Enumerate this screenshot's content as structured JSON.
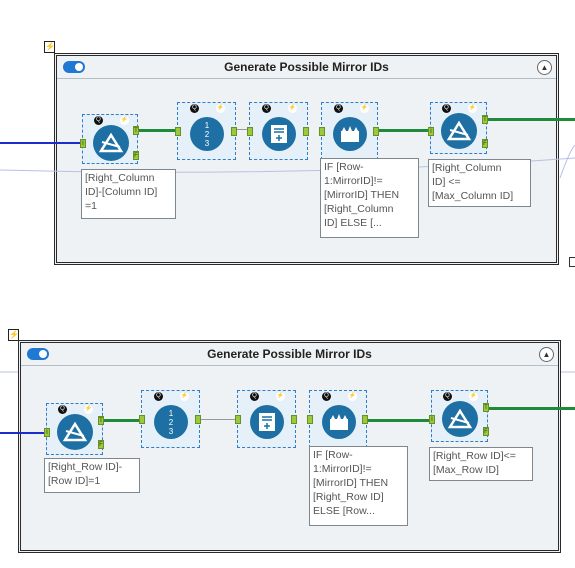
{
  "containers": [
    {
      "title": "Generate Possible Mirror IDs",
      "filter1_annotation": "[Right_Column\nID]-[Column ID]\n=1",
      "multirow_annotation": "IF [Row-\n1:MirrorID]!=\n[MirrorID] THEN\n[Right_Column\nID] ELSE [...",
      "filter2_annotation": "[Right_Column\nID] <=\n[Max_Column ID]"
    },
    {
      "title": "Generate Possible Mirror IDs",
      "filter1_annotation": "[Right_Row ID]-\n[Row ID]=1",
      "multirow_annotation": "IF [Row-\n1:MirrorID]!=\n[MirrorID] THEN\n[Right_Row ID]\nELSE [Row...",
      "filter2_annotation": "[Right_Row ID]<=\n[Max_Row ID]"
    }
  ],
  "labels": {
    "badge_q": "Q",
    "bolt": "⚡",
    "anchor_in": "I",
    "anchor_true": "T",
    "anchor_false": "F",
    "collapse": "▲",
    "record_id_digits": [
      "1",
      "2",
      "3"
    ]
  },
  "icons": {
    "filter": "filter-triangle-icon",
    "record_id": "record-id-icon",
    "formula": "formula-icon",
    "multi_row": "multi-row-formula-icon",
    "toggle": "toggle-icon"
  },
  "colors": {
    "tool_blue": "#1e6fa3",
    "connector_green": "#1e8a3a",
    "input_blue": "#1b2ec9",
    "anchor_green": "#9bc93e",
    "container_bg": "#eef2f4"
  }
}
